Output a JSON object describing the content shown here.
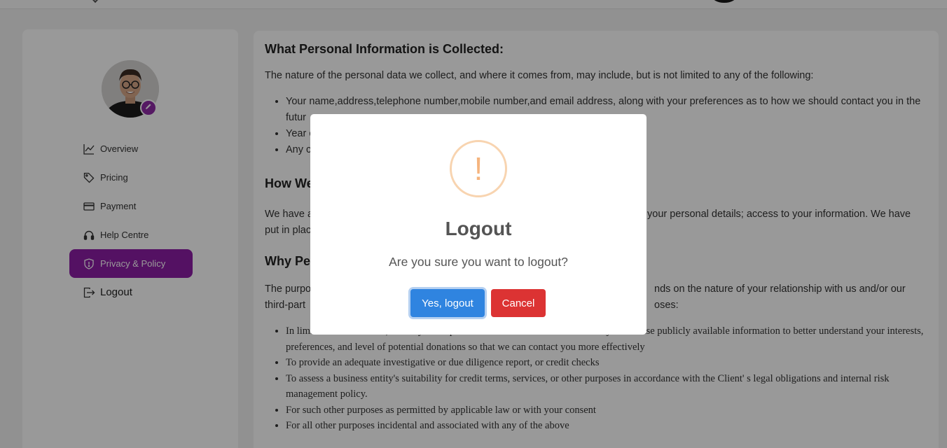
{
  "sidebar": {
    "items": [
      {
        "label": "Overview",
        "icon": "chart-line-icon"
      },
      {
        "label": "Pricing",
        "icon": "tag-icon"
      },
      {
        "label": "Payment",
        "icon": "credit-card-icon"
      },
      {
        "label": "Help Centre",
        "icon": "headset-icon"
      },
      {
        "label": "Privacy & Policy",
        "icon": "shield-icon"
      },
      {
        "label": "Logout",
        "icon": "logout-icon"
      }
    ],
    "active_color": "#8d1da6"
  },
  "content": {
    "section1_title": "What Personal Information is Collected:",
    "section1_intro": "The nature of the personal data we collect, and where it comes from, may include, but is not limited to any of the following:",
    "section1_items": [
      "Your name,address,telephone number,mobile number,and email address, along with your preferences as to how we should contact you in the futur",
      "Year c",
      "Any c"
    ],
    "section2_title": "How We",
    "section2_p_left": "We have a",
    "section2_p_right": "your personal details; access to your information. We have",
    "section2_p_line2": "put in plac",
    "section3_title": "Why Pe",
    "section3_p_left": "The purpo",
    "section3_p_right": "nds on the nature of your relationship with us and/or our",
    "section3_p_line2_left": "third-part",
    "section3_p_line2_right": "oses:",
    "section3_items": [
      "In limited circumstances, to analyze the personal information we collect about you and use publicly available information to better understand your interests, preferences, and level of potential donations so that we can contact you more effectively",
      "To provide an adequate investigative or due diligence report, or credit checks",
      "To assess a business entity's suitability for credit terms, services, or other purposes in accordance with the Client' s legal obligations and internal risk management policy.",
      "For such other purposes as permitted by applicable law or with your consent",
      "For all other purposes incidental and associated with any of the above"
    ]
  },
  "modal": {
    "icon": "exclamation-icon",
    "icon_glyph": "!",
    "title": "Logout",
    "message": "Are you sure you want to logout?",
    "confirm_label": "Yes, logout",
    "cancel_label": "Cancel",
    "confirm_color": "#2f84e0",
    "cancel_color": "#dc3333"
  }
}
